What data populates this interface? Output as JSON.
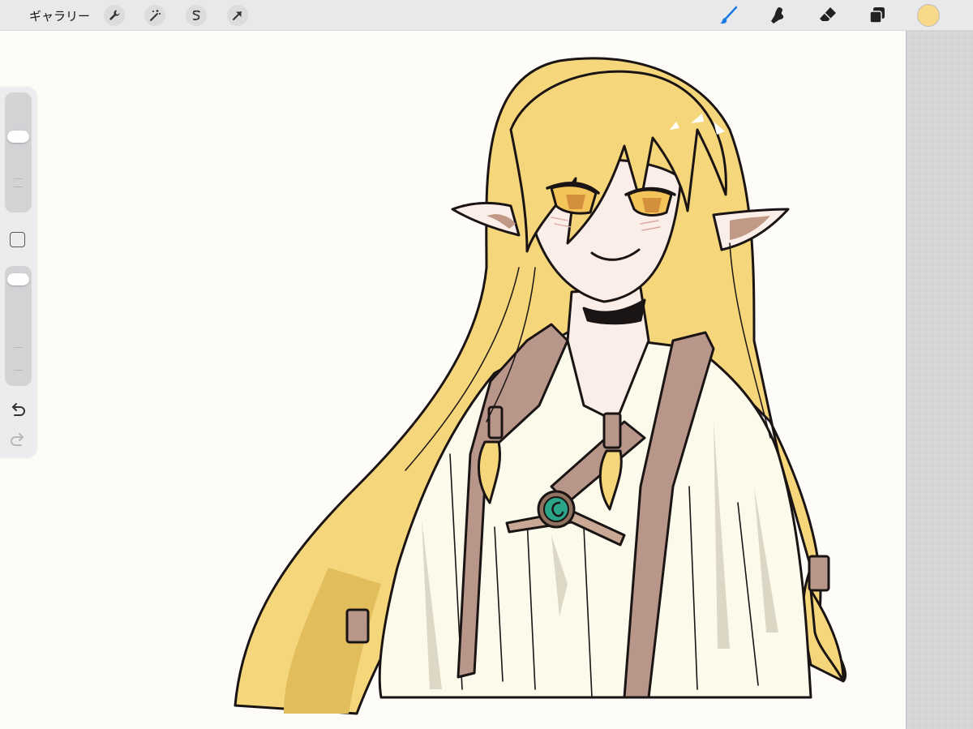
{
  "toolbar": {
    "gallery_label": "ギャラリー",
    "left_tools": [
      {
        "name": "actions",
        "icon": "wrench-icon"
      },
      {
        "name": "adjustments",
        "icon": "magic-wand-icon"
      },
      {
        "name": "selection",
        "icon": "selection-s-icon"
      },
      {
        "name": "transform",
        "icon": "arrow-icon"
      }
    ],
    "right_tools": [
      {
        "name": "brush",
        "icon": "brush-icon",
        "active": true
      },
      {
        "name": "smudge",
        "icon": "smudge-icon"
      },
      {
        "name": "eraser",
        "icon": "eraser-icon"
      },
      {
        "name": "layers",
        "icon": "layers-icon"
      }
    ],
    "active_tool_color": "#1a7be6",
    "current_color": "#f8d98a"
  },
  "sidebar": {
    "brush_size_level": 0.65,
    "opacity_level": 0.95,
    "undo_icon": "undo-icon",
    "redo_icon": "redo-icon",
    "redo_enabled": false
  },
  "canvas": {
    "artwork": "elf-girl-illustration",
    "palette": {
      "hair": "#f6d67a",
      "hair_shadow": "#e2bd5c",
      "skin": "#fbeee8",
      "robe": "#fbfaeb",
      "robe_shadow": "#cfc9b5",
      "strap": "#b9968a",
      "gem": "#2aa58a",
      "line": "#1a1414"
    }
  }
}
